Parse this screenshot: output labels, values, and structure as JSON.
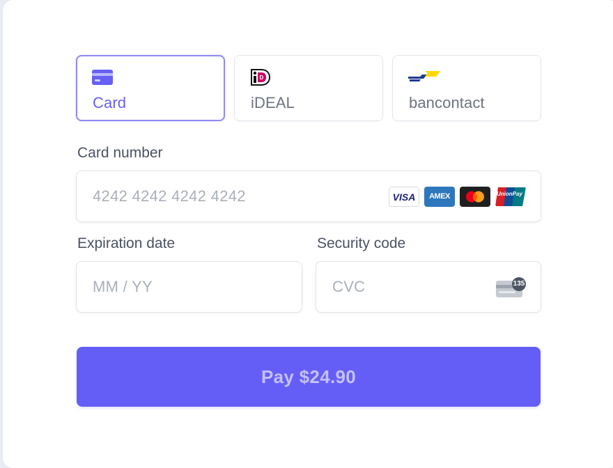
{
  "payment_methods": [
    {
      "label": "Card",
      "icon": "credit-card-icon",
      "selected": true
    },
    {
      "label": "iDEAL",
      "icon": "ideal-logo-icon",
      "selected": false
    },
    {
      "label": "bancontact",
      "icon": "bancontact-logo-icon",
      "selected": false
    }
  ],
  "card_number": {
    "label": "Card number",
    "placeholder": "4242 4242 4242 4242",
    "brands": [
      {
        "name": "visa-logo-icon",
        "text": "VISA"
      },
      {
        "name": "amex-logo-icon",
        "text": "AMEX"
      },
      {
        "name": "mastercard-logo-icon",
        "text": ""
      },
      {
        "name": "unionpay-logo-icon",
        "text": "UnionPay"
      }
    ]
  },
  "expiration": {
    "label": "Expiration date",
    "placeholder": "MM / YY"
  },
  "security_code": {
    "label": "Security code",
    "placeholder": "CVC",
    "cvc_badge": "135"
  },
  "pay_button": {
    "label": "Pay $24.90"
  },
  "colors": {
    "accent": "#655ef6",
    "accent_text": "#6760f2",
    "selected_border": "#8f8bf5",
    "label": "#4a5162",
    "placeholder": "#a9afba"
  }
}
